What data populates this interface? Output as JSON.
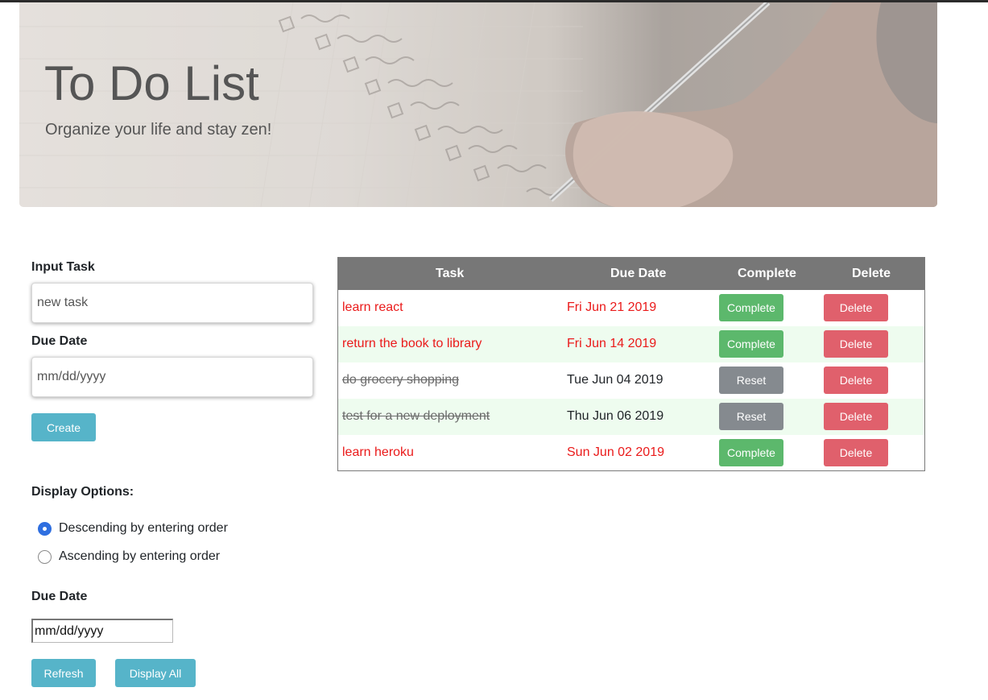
{
  "hero": {
    "title": "To Do List",
    "subtitle": "Organize your life and stay zen!"
  },
  "form": {
    "task_label": "Input Task",
    "task_placeholder": "new task",
    "due_label": "Due Date",
    "due_placeholder": "mm/dd/yyyy",
    "create_label": "Create"
  },
  "display": {
    "heading": "Display Options:",
    "options": [
      {
        "label": "Descending by entering order",
        "checked": true
      },
      {
        "label": "Ascending by entering order",
        "checked": false
      }
    ],
    "due_label": "Due Date",
    "due_value": "mm/dd/yyyy",
    "refresh_label": "Refresh",
    "display_all_label": "Display All"
  },
  "table": {
    "headers": [
      "Task",
      "Due Date",
      "Complete",
      "Delete"
    ],
    "rows": [
      {
        "task": "learn react",
        "due": "Fri Jun 21 2019",
        "action": "Complete",
        "delete": "Delete",
        "status": "overdue"
      },
      {
        "task": "return the book to library",
        "due": "Fri Jun 14 2019",
        "action": "Complete",
        "delete": "Delete",
        "status": "overdue"
      },
      {
        "task": "do grocery shopping",
        "due": "Tue Jun 04 2019",
        "action": "Reset",
        "delete": "Delete",
        "status": "done"
      },
      {
        "task": "test for a new deployment",
        "due": "Thu Jun 06 2019",
        "action": "Reset",
        "delete": "Delete",
        "status": "done"
      },
      {
        "task": "learn heroku",
        "due": "Sun Jun 02 2019",
        "action": "Complete",
        "delete": "Delete",
        "status": "overdue"
      }
    ]
  },
  "colors": {
    "overdue": "#ea1a1a",
    "complete_button": "#5cb86c",
    "reset_button": "#858a8f",
    "delete_button": "#e0606c",
    "info_button": "#56b4c9",
    "table_header": "#777777",
    "alt_row": "#eefcef"
  }
}
